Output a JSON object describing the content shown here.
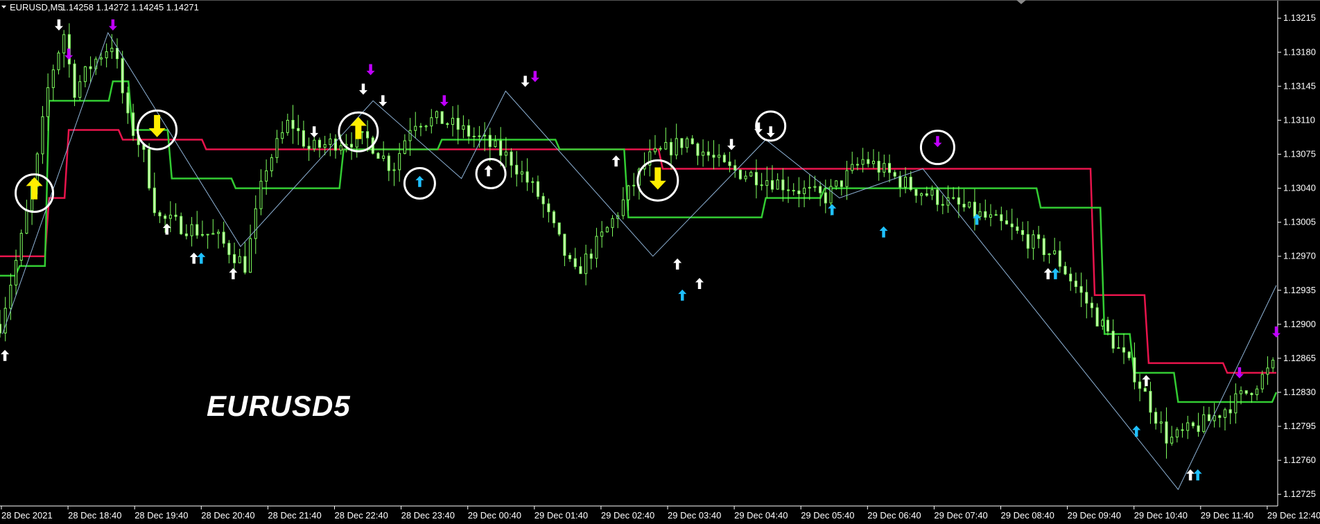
{
  "header": {
    "symbol_label": "EURUSD,M5",
    "ohlc": "1.14258 1.14272 1.14245 1.14271"
  },
  "watermark": "EURUSD5",
  "colors": {
    "background": "#000000",
    "axis": "#ffffff",
    "candle": "#7fff5f",
    "candle_body": "#c8ffb0",
    "green_line": "#33cc33",
    "red_line": "#e8144c",
    "zigzag": "#8fb4d8",
    "arrow_white": "#ffffff",
    "arrow_magenta": "#c000ff",
    "arrow_cyan": "#1fc0ff",
    "arrow_yellow": "#ffee00",
    "circle": "#ffffff"
  },
  "chart_data": {
    "type": "candlestick",
    "y_ticks": [
      "1.13215",
      "1.13180",
      "1.13145",
      "1.13110",
      "1.13075",
      "1.13040",
      "1.13005",
      "1.12970",
      "1.12935",
      "1.12900",
      "1.12865",
      "1.12830",
      "1.12795",
      "1.12760",
      "1.12725"
    ],
    "ylim": [
      1.12713,
      1.13228
    ],
    "x_ticks": [
      "28 Dec 2021",
      "28 Dec 18:40",
      "28 Dec 19:40",
      "28 Dec 20:40",
      "28 Dec 21:40",
      "28 Dec 22:40",
      "28 Dec 23:40",
      "29 Dec 00:40",
      "29 Dec 01:40",
      "29 Dec 02:40",
      "29 Dec 03:40",
      "29 Dec 04:40",
      "29 Dec 05:40",
      "29 Dec 06:40",
      "29 Dec 07:40",
      "29 Dec 08:40",
      "29 Dec 09:40",
      "29 Dec 10:40",
      "29 Dec 11:40",
      "29 Dec 12:40"
    ],
    "bar_count": 240,
    "price_path": [
      [
        0,
        1.129
      ],
      [
        8,
        1.1298
      ],
      [
        14,
        1.1305
      ],
      [
        20,
        1.1315
      ],
      [
        26,
        1.132
      ],
      [
        30,
        1.1314
      ],
      [
        38,
        1.1317
      ],
      [
        46,
        1.1319
      ],
      [
        52,
        1.1311
      ],
      [
        58,
        1.1308
      ],
      [
        64,
        1.1301
      ],
      [
        76,
        1.13
      ],
      [
        88,
        1.1299
      ],
      [
        100,
        1.1296
      ],
      [
        108,
        1.1306
      ],
      [
        118,
        1.1311
      ],
      [
        126,
        1.1308
      ],
      [
        140,
        1.1309
      ],
      [
        150,
        1.1309
      ],
      [
        160,
        1.1306
      ],
      [
        168,
        1.1311
      ],
      [
        180,
        1.1311
      ],
      [
        196,
        1.1309
      ],
      [
        208,
        1.1307
      ],
      [
        220,
        1.1303
      ],
      [
        234,
        1.1295
      ],
      [
        248,
        1.13
      ],
      [
        264,
        1.1307
      ],
      [
        280,
        1.1309
      ],
      [
        296,
        1.1306
      ],
      [
        312,
        1.1305
      ],
      [
        336,
        1.1303
      ],
      [
        352,
        1.1307
      ],
      [
        372,
        1.1304
      ],
      [
        392,
        1.1302
      ],
      [
        410,
        1.13
      ],
      [
        430,
        1.1297
      ],
      [
        446,
        1.1291
      ],
      [
        462,
        1.1285
      ],
      [
        476,
        1.1278
      ],
      [
        492,
        1.128
      ],
      [
        508,
        1.1283
      ],
      [
        520,
        1.1286
      ]
    ],
    "series": [
      {
        "name": "",
        "points": [
          [
            0,
            1.1297
          ],
          [
            14,
            1.1297
          ],
          [
            20,
            1.1303
          ],
          [
            28,
            1.131
          ],
          [
            44,
            1.131
          ],
          [
            50,
            1.1309
          ],
          [
            74,
            1.1309
          ],
          [
            84,
            1.1308
          ],
          [
            140,
            1.1308
          ],
          [
            186,
            1.1308
          ],
          [
            208,
            1.1308
          ],
          [
            254,
            1.1308
          ],
          [
            270,
            1.1306
          ],
          [
            300,
            1.1306
          ],
          [
            328,
            1.1306
          ],
          [
            356,
            1.1306
          ],
          [
            400,
            1.1306
          ],
          [
            440,
            1.1306
          ],
          [
            446,
            1.1293
          ],
          [
            460,
            1.1293
          ],
          [
            468,
            1.1286
          ],
          [
            478,
            1.1286
          ],
          [
            498,
            1.1286
          ],
          [
            500,
            1.1285
          ],
          [
            520,
            1.1285
          ]
        ]
      },
      {
        "name": "",
        "points": [
          [
            0,
            1.1295
          ],
          [
            8,
            1.1296
          ],
          [
            20,
            1.1313
          ],
          [
            28,
            1.1313
          ],
          [
            38,
            1.1313
          ],
          [
            46,
            1.1315
          ],
          [
            54,
            1.131
          ],
          [
            70,
            1.1305
          ],
          [
            96,
            1.1304
          ],
          [
            120,
            1.1304
          ],
          [
            140,
            1.1308
          ],
          [
            180,
            1.1309
          ],
          [
            208,
            1.1309
          ],
          [
            228,
            1.1308
          ],
          [
            256,
            1.1301
          ],
          [
            280,
            1.1301
          ],
          [
            312,
            1.1303
          ],
          [
            336,
            1.1304
          ],
          [
            380,
            1.1304
          ],
          [
            412,
            1.1304
          ],
          [
            424,
            1.1302
          ],
          [
            440,
            1.1302
          ],
          [
            450,
            1.1289
          ],
          [
            462,
            1.1285
          ],
          [
            472,
            1.1285
          ],
          [
            480,
            1.1282
          ],
          [
            508,
            1.1282
          ],
          [
            520,
            1.1283
          ]
        ]
      }
    ],
    "zigzag": [
      [
        1,
        1.1289
      ],
      [
        44,
        1.132
      ],
      [
        98,
        1.1298
      ],
      [
        152,
        1.1313
      ],
      [
        188,
        1.1305
      ],
      [
        206,
        1.1314
      ],
      [
        266,
        1.1297
      ],
      [
        312,
        1.1309
      ],
      [
        342,
        1.1303
      ],
      [
        376,
        1.1306
      ],
      [
        480,
        1.1273
      ],
      [
        520,
        1.1294
      ]
    ],
    "signals": [
      {
        "bar": 2,
        "price": 1.12868,
        "type": "up",
        "color": "white"
      },
      {
        "bar": 24,
        "price": 1.13208,
        "type": "down",
        "color": "white"
      },
      {
        "bar": 46,
        "price": 1.13208,
        "type": "down",
        "color": "magenta"
      },
      {
        "bar": 28,
        "price": 1.13178,
        "type": "down",
        "color": "magenta"
      },
      {
        "bar": 68,
        "price": 1.12998,
        "type": "up",
        "color": "white"
      },
      {
        "bar": 79,
        "price": 1.12968,
        "type": "up",
        "color": "white"
      },
      {
        "bar": 82,
        "price": 1.12968,
        "type": "up",
        "color": "cyan"
      },
      {
        "bar": 95,
        "price": 1.12952,
        "type": "up",
        "color": "white"
      },
      {
        "bar": 128,
        "price": 1.13098,
        "type": "down",
        "color": "white"
      },
      {
        "bar": 148,
        "price": 1.13142,
        "type": "down",
        "color": "white"
      },
      {
        "bar": 151,
        "price": 1.13162,
        "type": "down",
        "color": "magenta"
      },
      {
        "bar": 156,
        "price": 1.1313,
        "type": "down",
        "color": "white"
      },
      {
        "bar": 181,
        "price": 1.1313,
        "type": "down",
        "color": "magenta"
      },
      {
        "bar": 171,
        "price": 1.13047,
        "type": "up",
        "color": "cyan"
      },
      {
        "bar": 199,
        "price": 1.13058,
        "type": "up",
        "color": "white"
      },
      {
        "bar": 214,
        "price": 1.1315,
        "type": "down",
        "color": "white"
      },
      {
        "bar": 218,
        "price": 1.13155,
        "type": "down",
        "color": "magenta"
      },
      {
        "bar": 251,
        "price": 1.13068,
        "type": "up",
        "color": "white"
      },
      {
        "bar": 276,
        "price": 1.12962,
        "type": "up",
        "color": "white"
      },
      {
        "bar": 285,
        "price": 1.12942,
        "type": "up",
        "color": "white"
      },
      {
        "bar": 278,
        "price": 1.1293,
        "type": "up",
        "color": "cyan"
      },
      {
        "bar": 298,
        "price": 1.13085,
        "type": "down",
        "color": "white"
      },
      {
        "bar": 309,
        "price": 1.13102,
        "type": "down",
        "color": "white"
      },
      {
        "bar": 314,
        "price": 1.13098,
        "type": "down",
        "color": "white"
      },
      {
        "bar": 339,
        "price": 1.13018,
        "type": "up",
        "color": "cyan"
      },
      {
        "bar": 360,
        "price": 1.12995,
        "type": "up",
        "color": "cyan"
      },
      {
        "bar": 382,
        "price": 1.13088,
        "type": "down",
        "color": "magenta"
      },
      {
        "bar": 398,
        "price": 1.13008,
        "type": "up",
        "color": "cyan"
      },
      {
        "bar": 427,
        "price": 1.12952,
        "type": "up",
        "color": "white"
      },
      {
        "bar": 430,
        "price": 1.12952,
        "type": "up",
        "color": "cyan"
      },
      {
        "bar": 467,
        "price": 1.12842,
        "type": "up",
        "color": "white"
      },
      {
        "bar": 463,
        "price": 1.1279,
        "type": "up",
        "color": "cyan"
      },
      {
        "bar": 485,
        "price": 1.12745,
        "type": "up",
        "color": "white"
      },
      {
        "bar": 488,
        "price": 1.12745,
        "type": "up",
        "color": "cyan"
      },
      {
        "bar": 505,
        "price": 1.1285,
        "type": "down",
        "color": "magenta"
      },
      {
        "bar": 520,
        "price": 1.12892,
        "type": "down",
        "color": "magenta"
      }
    ],
    "big_signals": [
      {
        "bar": 14,
        "price": 1.1304,
        "type": "up"
      },
      {
        "bar": 64,
        "price": 1.13104,
        "type": "down"
      },
      {
        "bar": 146,
        "price": 1.13102,
        "type": "up"
      },
      {
        "bar": 268,
        "price": 1.1305,
        "type": "down"
      }
    ],
    "circles": [
      {
        "bar": 14,
        "price": 1.13035,
        "r": 27
      },
      {
        "bar": 64,
        "price": 1.131,
        "r": 28
      },
      {
        "bar": 146,
        "price": 1.13098,
        "r": 28
      },
      {
        "bar": 171,
        "price": 1.13045,
        "r": 22
      },
      {
        "bar": 200,
        "price": 1.13055,
        "r": 21
      },
      {
        "bar": 268,
        "price": 1.13048,
        "r": 29
      },
      {
        "bar": 314,
        "price": 1.13104,
        "r": 21
      },
      {
        "bar": 382,
        "price": 1.13082,
        "r": 24
      }
    ]
  }
}
